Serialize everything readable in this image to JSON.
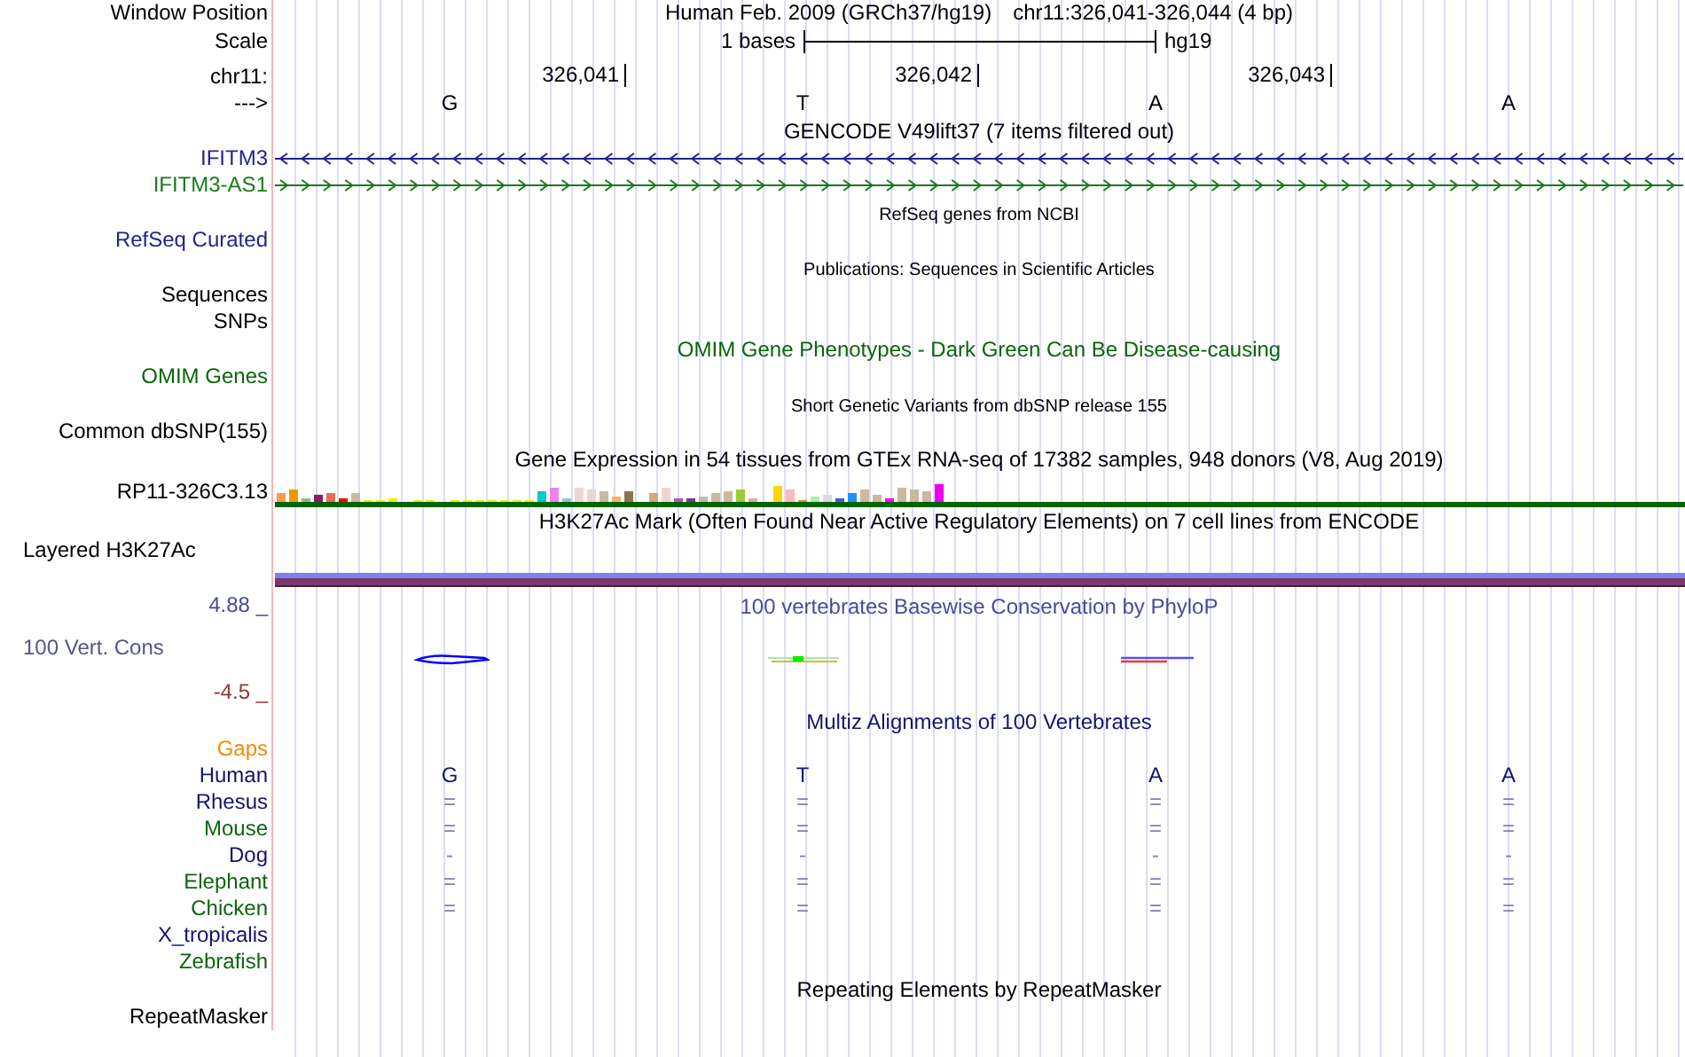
{
  "position": {
    "label": "Window Position",
    "assembly": "Human Feb. 2009 (GRCh37/hg19)",
    "region": "chr11:326,041-326,044 (4 bp)"
  },
  "scale": {
    "label": "Scale",
    "length": "1 bases",
    "assembly": "hg19"
  },
  "ruler": {
    "label": "chr11:",
    "ticks": [
      "326,041",
      "326,042",
      "326,043"
    ]
  },
  "sequence": {
    "label": "--->",
    "bases": [
      "G",
      "T",
      "A",
      "A"
    ]
  },
  "tracks": [
    {
      "kind": "title",
      "text": "GENCODE V49lift37 (7 items filtered out)",
      "color": "#000000"
    },
    {
      "kind": "reverse",
      "label": "IFITM3",
      "color": "#23238e"
    },
    {
      "kind": "forward",
      "label": "IFITM3-AS1",
      "color": "#1a7a1a"
    },
    {
      "kind": "subtitle",
      "text": "RefSeq genes from NCBI",
      "color": "#000000"
    },
    {
      "kind": "label",
      "label": "RefSeq Curated",
      "color": "#23238e"
    },
    {
      "kind": "subtitle",
      "text": "Publications: Sequences in Scientific Articles",
      "color": "#000000"
    },
    {
      "kind": "label",
      "label": "Sequences",
      "color": "#000000"
    },
    {
      "kind": "label",
      "label": "SNPs",
      "color": "#000000"
    },
    {
      "kind": "title",
      "text": "OMIM Gene Phenotypes - Dark Green Can Be Disease-causing",
      "color": "#0b650b"
    },
    {
      "kind": "label",
      "label": "OMIM Genes",
      "color": "#0b650b"
    },
    {
      "kind": "subtitle",
      "text": "Short Genetic Variants from dbSNP release 155",
      "color": "#000000"
    },
    {
      "kind": "label",
      "label": "Common dbSNP(155)",
      "color": "#000000"
    },
    {
      "kind": "title",
      "text": "Gene Expression in 54 tissues from GTEx RNA-seq of 17382 samples, 948 donors (V8, Aug 2019)",
      "color": "#000000"
    },
    {
      "kind": "expression",
      "label": "RP11-326C3.13",
      "color": "#000000"
    },
    {
      "kind": "title",
      "text": "H3K27Ac Mark (Often Found Near Active Regulatory Elements) on 7 cell lines from ENCODE",
      "color": "#000000"
    },
    {
      "kind": "layered",
      "label": "Layered H3K27Ac",
      "color": "#000000"
    },
    {
      "kind": "wiggle",
      "title": "100 vertebrates Basewise Conservation by PhyloP",
      "max": "4.88 _",
      "label": "100 Vert. Cons",
      "min": "-4.5 _",
      "color": "#4a4a9c"
    },
    {
      "kind": "title",
      "text": "Multiz Alignments of 100 Vertebrates",
      "color": "#14146e"
    },
    {
      "kind": "label",
      "label": "Gaps",
      "color": "#f08c00"
    },
    {
      "kind": "species",
      "label": "Human",
      "color": "#14146e",
      "bases": [
        "G",
        "T",
        "A",
        "A"
      ]
    },
    {
      "kind": "species",
      "label": "Rhesus",
      "color": "#14146e",
      "bases": [
        "=",
        "=",
        "=",
        "="
      ]
    },
    {
      "kind": "species",
      "label": "Mouse",
      "color": "#0d650d",
      "bases": [
        "=",
        "=",
        "=",
        "="
      ]
    },
    {
      "kind": "species",
      "label": "Dog",
      "color": "#14146e",
      "bases": [
        "-",
        "-",
        "-",
        "-"
      ]
    },
    {
      "kind": "species",
      "label": "Elephant",
      "color": "#0d650d",
      "bases": [
        "=",
        "=",
        "=",
        "="
      ]
    },
    {
      "kind": "species",
      "label": "Chicken",
      "color": "#0d650d",
      "bases": [
        "=",
        "=",
        "=",
        "="
      ]
    },
    {
      "kind": "species",
      "label": "X_tropicalis",
      "color": "#14146e"
    },
    {
      "kind": "species",
      "label": "Zebrafish",
      "color": "#0d650d"
    },
    {
      "kind": "title",
      "text": "Repeating Elements by RepeatMasker",
      "color": "#000000"
    },
    {
      "kind": "label",
      "label": "RepeatMasker",
      "color": "#000000"
    }
  ]
}
